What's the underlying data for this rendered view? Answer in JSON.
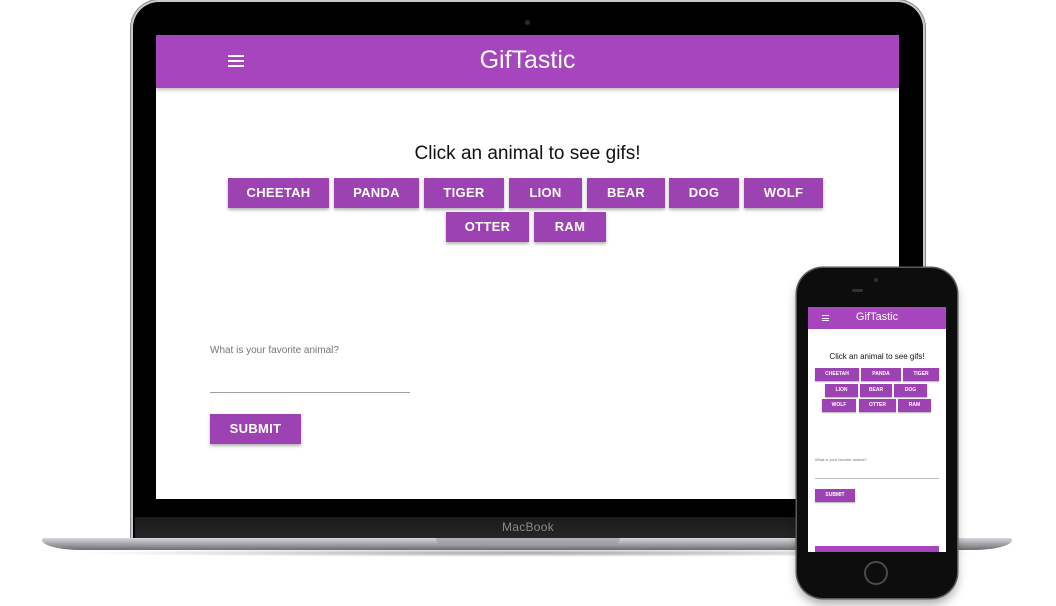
{
  "brand": {
    "device_label": "MacBook"
  },
  "colors": {
    "primary": "#a645bd",
    "button": "#9d42b3"
  },
  "app": {
    "title": "GifTastic",
    "menu_icon": "hamburger-menu-icon",
    "prompt": "Click an animal to see gifs!",
    "animals": [
      "CHEETAH",
      "PANDA",
      "TIGER",
      "LION",
      "BEAR",
      "DOG",
      "WOLF",
      "OTTER",
      "RAM"
    ],
    "form": {
      "label": "What is your favorite animal?",
      "input_value": "",
      "submit_label": "SUBMIT"
    }
  }
}
